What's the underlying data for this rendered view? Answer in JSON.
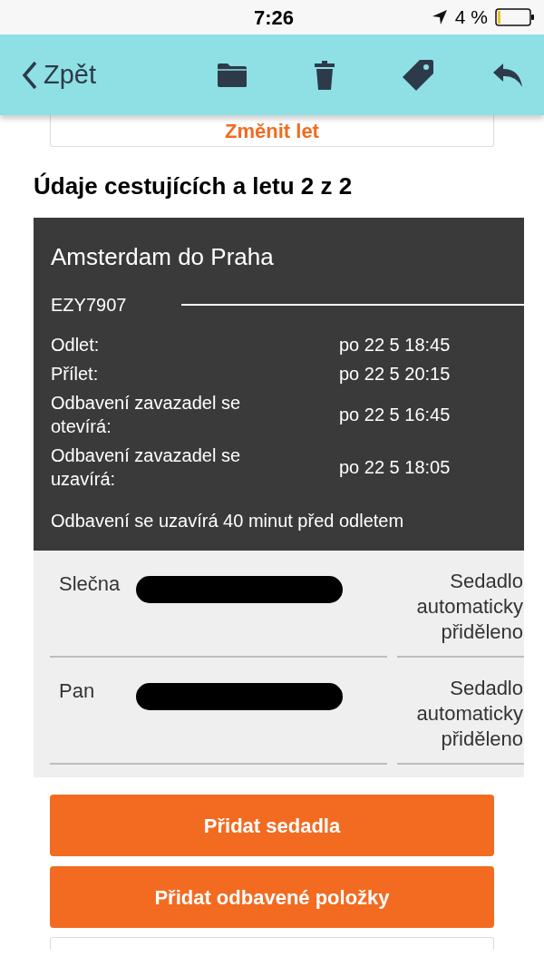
{
  "status_bar": {
    "time": "7:26",
    "battery": "4 %"
  },
  "nav_bar": {
    "back": "Zpět"
  },
  "change_flight_button": "Změnit let",
  "section_title": "Údaje cestujících a letu 2 z 2",
  "flight": {
    "route": "Amsterdam do Praha",
    "number": "EZY7907",
    "rows": [
      {
        "label": "Odlet:",
        "value": "po 22 5 18:45"
      },
      {
        "label": "Přílet:",
        "value": "po 22 5 20:15"
      },
      {
        "label": "Odbavení zavazadel se otevírá:",
        "value": "po 22 5 16:45"
      },
      {
        "label": "Odbavení zavazadel se uzavírá:",
        "value": "po 22 5 18:05"
      }
    ],
    "note": "Odbavení se uzavírá 40 minut před odletem"
  },
  "passengers": [
    {
      "name": "Slečna",
      "seat": "Sedadlo automaticky přiděleno"
    },
    {
      "name": "Pan",
      "seat": "Sedadlo automaticky přiděleno"
    }
  ],
  "buttons": [
    "Přidat sedadla",
    "Přidat odbavené položky"
  ]
}
